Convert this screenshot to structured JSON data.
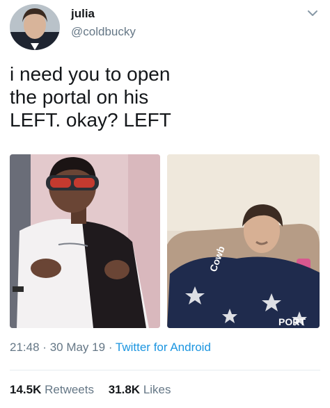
{
  "author": {
    "display_name": "julia",
    "handle": "@coldbucky"
  },
  "tweet": {
    "lines": [
      "i need you to open",
      "the portal on his",
      "LEFT. okay? LEFT"
    ]
  },
  "meta": {
    "time": "21:48",
    "date": "30 May 19",
    "separator": "·",
    "source": "Twitter for Android"
  },
  "stats": {
    "retweets_count": "14.5K",
    "retweets_label": "Retweets",
    "likes_count": "31.8K",
    "likes_label": "Likes"
  },
  "media": {
    "right_image_text_1": "Cowb",
    "right_image_text_2": "PORT"
  },
  "icons": {
    "menu": "chevron-down-icon"
  }
}
